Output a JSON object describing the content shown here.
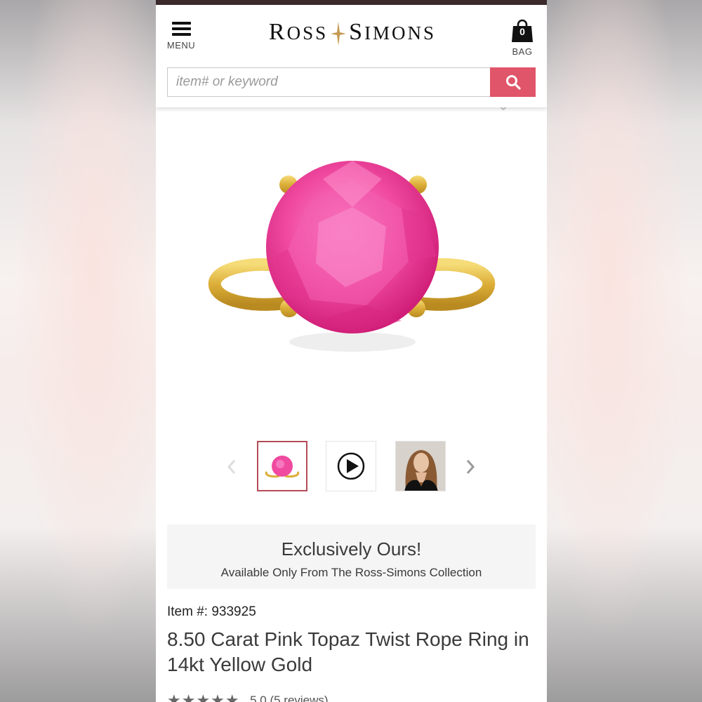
{
  "header": {
    "menu_label": "MENU",
    "logo_left_big": "R",
    "logo_left_small": "OSS",
    "logo_right_big": "S",
    "logo_right_small": "IMONS",
    "bag_count": "0",
    "bag_label": "BAG"
  },
  "search": {
    "placeholder": "item# or keyword",
    "value": ""
  },
  "gallery": {
    "thumbnails": [
      {
        "kind": "image"
      },
      {
        "kind": "video"
      },
      {
        "kind": "model-photo"
      }
    ]
  },
  "exclusive": {
    "title": "Exclusively Ours!",
    "subtitle": "Available Only From The Ross-Simons Collection"
  },
  "product": {
    "item_number": "Item #: 933925",
    "title": "8.50 Carat Pink Topaz Twist Rope Ring in 14kt Yellow Gold",
    "stars": "★★★★★",
    "rating_value": "5.0",
    "reviews": "(5 reviews)"
  },
  "colors": {
    "accent": "#e05569",
    "active_thumb_border": "#b44c57",
    "gem": "#f04aa0",
    "gold": "#e0b840",
    "top_strip": "#3a2a2c"
  },
  "icons": [
    "hamburger-icon",
    "bag-icon",
    "search-icon",
    "heart-icon",
    "chevron-left-icon",
    "chevron-right-icon",
    "play-icon",
    "star-icon"
  ]
}
